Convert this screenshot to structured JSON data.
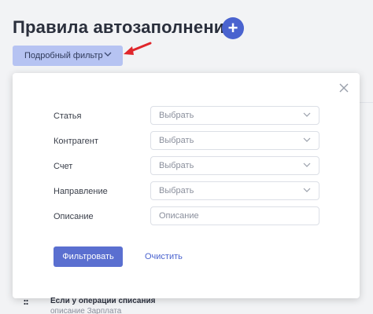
{
  "page": {
    "title": "Правила автозаполнения",
    "add_icon": "plus-icon"
  },
  "filter_toggle": {
    "label": "Подробный фильтр",
    "icon": "chevron-down-icon"
  },
  "annotation": {
    "icon": "red-arrow-icon",
    "color": "#e0262b"
  },
  "filter_panel": {
    "close_icon": "close-icon",
    "fields": [
      {
        "label": "Статья",
        "value": "Выбрать"
      },
      {
        "label": "Контрагент",
        "value": "Выбрать"
      },
      {
        "label": "Счет",
        "value": "Выбрать"
      },
      {
        "label": "Направление",
        "value": "Выбрать"
      }
    ],
    "description": {
      "label": "Описание",
      "placeholder": "Описание"
    },
    "apply_label": "Фильтровать",
    "clear_label": "Очистить"
  },
  "background_list": {
    "item_title": "Если у операции списания",
    "item_subtitle": "описание Зарплата"
  },
  "colors": {
    "accent": "#4a63cf",
    "toggle_bg": "#b6c3f2",
    "apply_bg": "#5a6fd0"
  }
}
